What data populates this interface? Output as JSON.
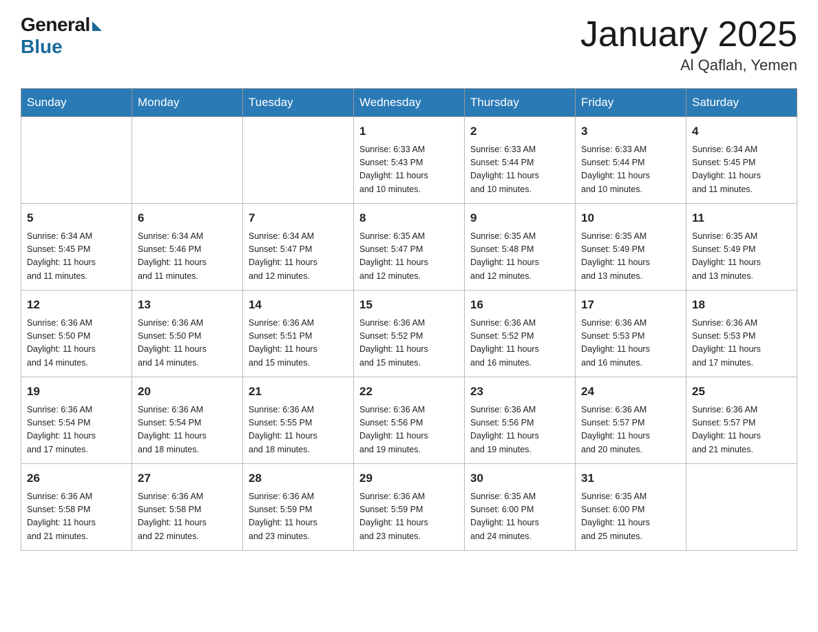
{
  "logo": {
    "general": "General",
    "blue": "Blue"
  },
  "title": "January 2025",
  "location": "Al Qaflah, Yemen",
  "days_header": [
    "Sunday",
    "Monday",
    "Tuesday",
    "Wednesday",
    "Thursday",
    "Friday",
    "Saturday"
  ],
  "weeks": [
    [
      {
        "day": "",
        "info": ""
      },
      {
        "day": "",
        "info": ""
      },
      {
        "day": "",
        "info": ""
      },
      {
        "day": "1",
        "info": "Sunrise: 6:33 AM\nSunset: 5:43 PM\nDaylight: 11 hours\nand 10 minutes."
      },
      {
        "day": "2",
        "info": "Sunrise: 6:33 AM\nSunset: 5:44 PM\nDaylight: 11 hours\nand 10 minutes."
      },
      {
        "day": "3",
        "info": "Sunrise: 6:33 AM\nSunset: 5:44 PM\nDaylight: 11 hours\nand 10 minutes."
      },
      {
        "day": "4",
        "info": "Sunrise: 6:34 AM\nSunset: 5:45 PM\nDaylight: 11 hours\nand 11 minutes."
      }
    ],
    [
      {
        "day": "5",
        "info": "Sunrise: 6:34 AM\nSunset: 5:45 PM\nDaylight: 11 hours\nand 11 minutes."
      },
      {
        "day": "6",
        "info": "Sunrise: 6:34 AM\nSunset: 5:46 PM\nDaylight: 11 hours\nand 11 minutes."
      },
      {
        "day": "7",
        "info": "Sunrise: 6:34 AM\nSunset: 5:47 PM\nDaylight: 11 hours\nand 12 minutes."
      },
      {
        "day": "8",
        "info": "Sunrise: 6:35 AM\nSunset: 5:47 PM\nDaylight: 11 hours\nand 12 minutes."
      },
      {
        "day": "9",
        "info": "Sunrise: 6:35 AM\nSunset: 5:48 PM\nDaylight: 11 hours\nand 12 minutes."
      },
      {
        "day": "10",
        "info": "Sunrise: 6:35 AM\nSunset: 5:49 PM\nDaylight: 11 hours\nand 13 minutes."
      },
      {
        "day": "11",
        "info": "Sunrise: 6:35 AM\nSunset: 5:49 PM\nDaylight: 11 hours\nand 13 minutes."
      }
    ],
    [
      {
        "day": "12",
        "info": "Sunrise: 6:36 AM\nSunset: 5:50 PM\nDaylight: 11 hours\nand 14 minutes."
      },
      {
        "day": "13",
        "info": "Sunrise: 6:36 AM\nSunset: 5:50 PM\nDaylight: 11 hours\nand 14 minutes."
      },
      {
        "day": "14",
        "info": "Sunrise: 6:36 AM\nSunset: 5:51 PM\nDaylight: 11 hours\nand 15 minutes."
      },
      {
        "day": "15",
        "info": "Sunrise: 6:36 AM\nSunset: 5:52 PM\nDaylight: 11 hours\nand 15 minutes."
      },
      {
        "day": "16",
        "info": "Sunrise: 6:36 AM\nSunset: 5:52 PM\nDaylight: 11 hours\nand 16 minutes."
      },
      {
        "day": "17",
        "info": "Sunrise: 6:36 AM\nSunset: 5:53 PM\nDaylight: 11 hours\nand 16 minutes."
      },
      {
        "day": "18",
        "info": "Sunrise: 6:36 AM\nSunset: 5:53 PM\nDaylight: 11 hours\nand 17 minutes."
      }
    ],
    [
      {
        "day": "19",
        "info": "Sunrise: 6:36 AM\nSunset: 5:54 PM\nDaylight: 11 hours\nand 17 minutes."
      },
      {
        "day": "20",
        "info": "Sunrise: 6:36 AM\nSunset: 5:54 PM\nDaylight: 11 hours\nand 18 minutes."
      },
      {
        "day": "21",
        "info": "Sunrise: 6:36 AM\nSunset: 5:55 PM\nDaylight: 11 hours\nand 18 minutes."
      },
      {
        "day": "22",
        "info": "Sunrise: 6:36 AM\nSunset: 5:56 PM\nDaylight: 11 hours\nand 19 minutes."
      },
      {
        "day": "23",
        "info": "Sunrise: 6:36 AM\nSunset: 5:56 PM\nDaylight: 11 hours\nand 19 minutes."
      },
      {
        "day": "24",
        "info": "Sunrise: 6:36 AM\nSunset: 5:57 PM\nDaylight: 11 hours\nand 20 minutes."
      },
      {
        "day": "25",
        "info": "Sunrise: 6:36 AM\nSunset: 5:57 PM\nDaylight: 11 hours\nand 21 minutes."
      }
    ],
    [
      {
        "day": "26",
        "info": "Sunrise: 6:36 AM\nSunset: 5:58 PM\nDaylight: 11 hours\nand 21 minutes."
      },
      {
        "day": "27",
        "info": "Sunrise: 6:36 AM\nSunset: 5:58 PM\nDaylight: 11 hours\nand 22 minutes."
      },
      {
        "day": "28",
        "info": "Sunrise: 6:36 AM\nSunset: 5:59 PM\nDaylight: 11 hours\nand 23 minutes."
      },
      {
        "day": "29",
        "info": "Sunrise: 6:36 AM\nSunset: 5:59 PM\nDaylight: 11 hours\nand 23 minutes."
      },
      {
        "day": "30",
        "info": "Sunrise: 6:35 AM\nSunset: 6:00 PM\nDaylight: 11 hours\nand 24 minutes."
      },
      {
        "day": "31",
        "info": "Sunrise: 6:35 AM\nSunset: 6:00 PM\nDaylight: 11 hours\nand 25 minutes."
      },
      {
        "day": "",
        "info": ""
      }
    ]
  ]
}
